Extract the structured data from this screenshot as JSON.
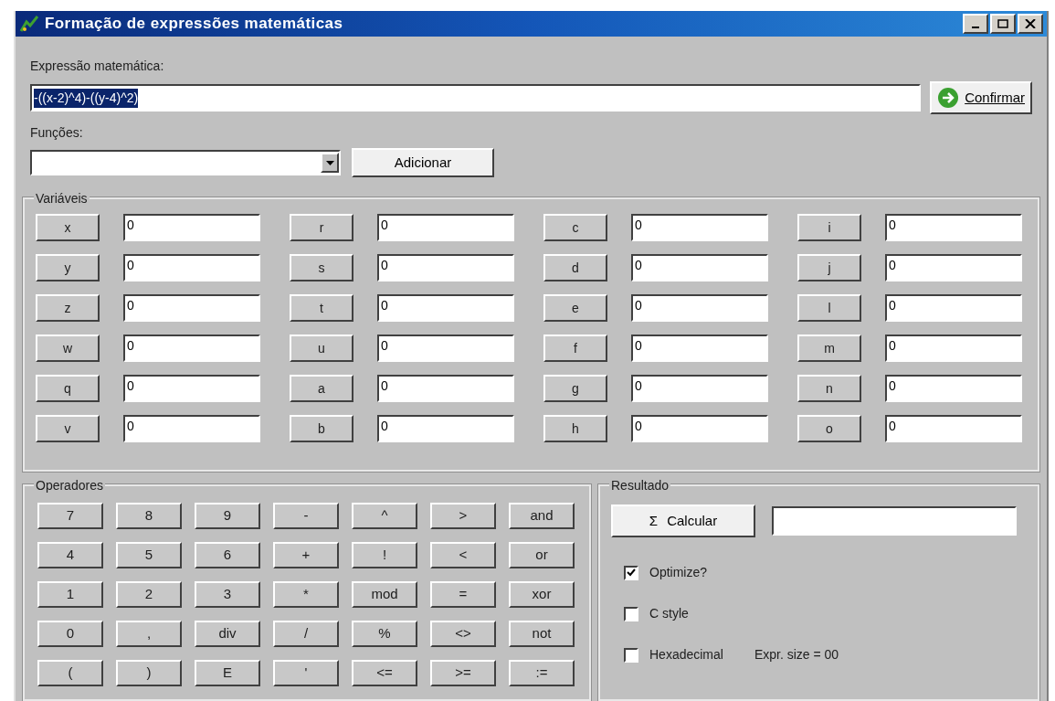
{
  "window": {
    "title": "Formação de expressões matemáticas"
  },
  "expression": {
    "label": "Expressão matemática:",
    "value": "-((x-2)^4)-((y-4)^2)",
    "highlighted": true
  },
  "confirm_button": {
    "label": "Confirmar"
  },
  "functions": {
    "label": "Funções:"
  },
  "add_button": {
    "label": "Adicionar"
  },
  "variables": {
    "title": "Variáveis",
    "columns": [
      [
        {
          "name": "x",
          "value": "0"
        },
        {
          "name": "y",
          "value": "0"
        },
        {
          "name": "z",
          "value": "0"
        },
        {
          "name": "w",
          "value": "0"
        },
        {
          "name": "q",
          "value": "0"
        },
        {
          "name": "v",
          "value": "0"
        }
      ],
      [
        {
          "name": "r",
          "value": "0"
        },
        {
          "name": "s",
          "value": "0"
        },
        {
          "name": "t",
          "value": "0"
        },
        {
          "name": "u",
          "value": "0"
        },
        {
          "name": "a",
          "value": "0"
        },
        {
          "name": "b",
          "value": "0"
        }
      ],
      [
        {
          "name": "c",
          "value": "0"
        },
        {
          "name": "d",
          "value": "0"
        },
        {
          "name": "e",
          "value": "0"
        },
        {
          "name": "f",
          "value": "0"
        },
        {
          "name": "g",
          "value": "0"
        },
        {
          "name": "h",
          "value": "0"
        }
      ],
      [
        {
          "name": "i",
          "value": "0"
        },
        {
          "name": "j",
          "value": "0"
        },
        {
          "name": "l",
          "value": "0"
        },
        {
          "name": "m",
          "value": "0"
        },
        {
          "name": "n",
          "value": "0"
        },
        {
          "name": "o",
          "value": "0"
        }
      ]
    ]
  },
  "operators": {
    "title": "Operadores",
    "rows": [
      [
        "7",
        "8",
        "9",
        "-",
        "^",
        ">",
        "and"
      ],
      [
        "4",
        "5",
        "6",
        "+",
        "!",
        "<",
        "or"
      ],
      [
        "1",
        "2",
        "3",
        "*",
        "mod",
        "=",
        "xor"
      ],
      [
        "0",
        ",",
        "div",
        "/",
        "%",
        "<>",
        "not"
      ],
      [
        "(",
        ")",
        "E",
        "'",
        "<=",
        ">=",
        ":="
      ]
    ]
  },
  "result": {
    "title": "Resultado",
    "calc_button": "Calcular",
    "calc_symbol": "Σ",
    "options": [
      {
        "label": "Optimize?",
        "checked": true
      },
      {
        "label": "C style",
        "checked": false
      },
      {
        "label": "Hexadecimal",
        "checked": false
      }
    ],
    "size_label": "Expr. size = 00"
  }
}
